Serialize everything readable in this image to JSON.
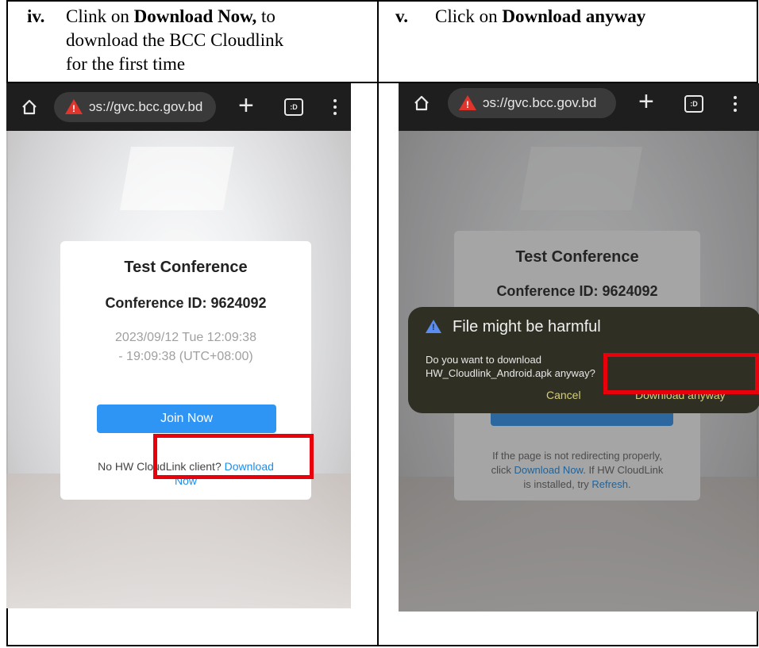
{
  "steps": {
    "left": {
      "num": "iv.",
      "text_pre": "Clink on ",
      "text_bold": "Download Now,",
      "text_post": " to",
      "line2": "download the BCC Cloudlink",
      "line3": "for the first time"
    },
    "right": {
      "num": "v.",
      "text_pre": "Click on ",
      "text_bold": "Download anyway"
    }
  },
  "browser": {
    "url": "ɔs://gvc.bcc.gov.bd",
    "warn_glyph": "!",
    "plus": "+",
    "tabs_label": ":D",
    "icons": [
      "home-icon",
      "warning-icon",
      "new-tab-icon",
      "tabs-icon",
      "menu-icon"
    ]
  },
  "left_screen": {
    "card": {
      "title": "Test Conference",
      "conference_id": "Conference ID: 9624092",
      "time_line1": "2023/09/12 Tue 12:09:38",
      "time_line2": "- 19:09:38 (UTC+08:00)",
      "join_label": "Join Now",
      "no_client_text": "No HW CloudLink client? ",
      "download_link": "Download",
      "download_link_line2": "Now"
    }
  },
  "right_screen": {
    "card": {
      "title": "Test Conference",
      "conference_id": "Conference ID: 9624092",
      "redirect_line1": "If the page is not redirecting properly,",
      "redirect_line2_pre": "click ",
      "redirect_line2_link": "Download Now",
      "redirect_line2_post": ". If HW CloudLink",
      "redirect_line3_pre": "is installed, try ",
      "redirect_line3_link": "Refresh",
      "redirect_line3_post": "."
    },
    "dialog": {
      "title": "File might be harmful",
      "message_line1": "Do you want to download",
      "message_line2": "HW_Cloudlink_Android.apk anyway?",
      "cancel_label": "Cancel",
      "download_label": "Download anyway"
    }
  },
  "colors": {
    "highlight_red": "#e8000b",
    "join_blue": "#2f95f5",
    "link_blue": "#1f8de8",
    "dialog_bg": "#2f2f24",
    "dialog_button": "#d6cf7a"
  }
}
